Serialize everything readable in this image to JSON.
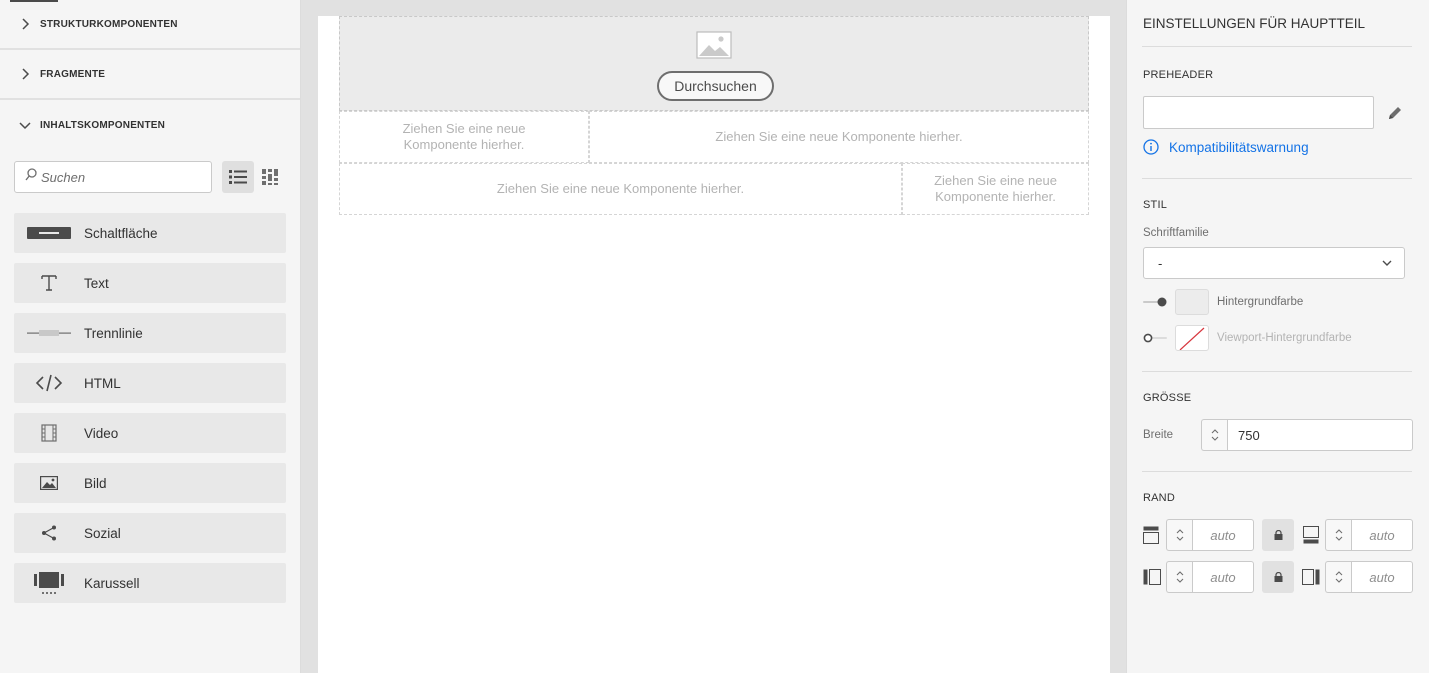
{
  "left_panel": {
    "sections": [
      {
        "label": "STRUKTURKOMPONENTEN",
        "expanded": false
      },
      {
        "label": "FRAGMENTE",
        "expanded": false
      },
      {
        "label": "INHALTSKOMPONENTEN",
        "expanded": true
      }
    ],
    "search": {
      "placeholder": "Suchen",
      "value": ""
    },
    "components": [
      {
        "label": "Schaltfläche",
        "icon": "button-icon"
      },
      {
        "label": "Text",
        "icon": "text-icon"
      },
      {
        "label": "Trennlinie",
        "icon": "divider-icon"
      },
      {
        "label": "HTML",
        "icon": "code-icon"
      },
      {
        "label": "Video",
        "icon": "film-icon"
      },
      {
        "label": "Bild",
        "icon": "image-icon"
      },
      {
        "label": "Sozial",
        "icon": "share-icon"
      },
      {
        "label": "Karussell",
        "icon": "carousel-icon"
      }
    ]
  },
  "canvas": {
    "browse_label": "Durchsuchen",
    "drop_text": "Ziehen Sie eine neue Komponente hierher.",
    "drop_text_short_1": "Ziehen Sie eine neue",
    "drop_text_short_2": "Komponente hierher."
  },
  "right_panel": {
    "title": "EINSTELLUNGEN FÜR HAUPTTEIL",
    "preheader": {
      "label": "PREHEADER",
      "value": ""
    },
    "compat_link": "Kompatibilitätswarnung",
    "style": {
      "label": "STIL",
      "font_family_label": "Schriftfamilie",
      "font_family_value": "-",
      "bg_color_label": "Hintergrundfarbe",
      "viewport_bg_label": "Viewport-Hintergrundfarbe"
    },
    "size": {
      "label": "GRÖSSE",
      "width_label": "Breite",
      "width_value": "750"
    },
    "margin": {
      "label": "RAND",
      "top": "auto",
      "bottom": "auto",
      "left": "auto",
      "right": "auto"
    }
  },
  "colors": {
    "accent": "#1473e6",
    "viewport_none_slash": "#d7373f"
  }
}
